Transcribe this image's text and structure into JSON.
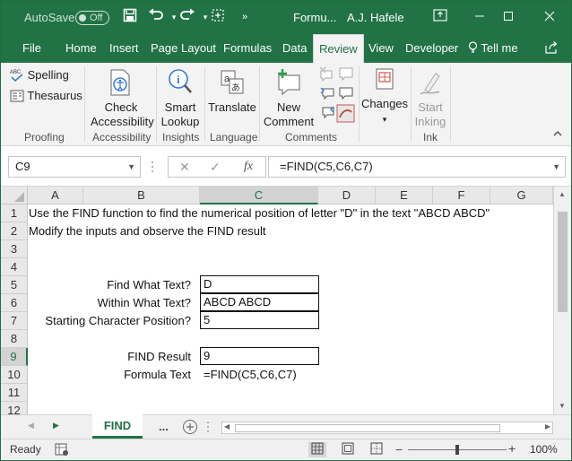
{
  "titlebar": {
    "autosave_label": "AutoSave",
    "autosave_state": "Off",
    "doc_title": "Formu...",
    "user_name": "A.J. Hafele"
  },
  "tabs": [
    {
      "label": "File"
    },
    {
      "label": "Home"
    },
    {
      "label": "Insert"
    },
    {
      "label": "Page Layout"
    },
    {
      "label": "Formulas"
    },
    {
      "label": "Data"
    },
    {
      "label": "Review",
      "active": true
    },
    {
      "label": "View"
    },
    {
      "label": "Developer"
    }
  ],
  "tell_me": "Tell me",
  "ribbon": {
    "spelling": "Spelling",
    "thesaurus": "Thesaurus",
    "proofing": "Proofing",
    "check_accessibility_1": "Check",
    "check_accessibility_2": "Accessibility",
    "accessibility": "Accessibility",
    "smart_lookup_1": "Smart",
    "smart_lookup_2": "Lookup",
    "insights": "Insights",
    "translate": "Translate",
    "language": "Language",
    "new_comment_1": "New",
    "new_comment_2": "Comment",
    "comments": "Comments",
    "changes": "Changes",
    "start_inking_1": "Start",
    "start_inking_2": "Inking",
    "ink": "Ink"
  },
  "formula_bar": {
    "name_box": "C9",
    "formula": "=FIND(C5,C6,C7)"
  },
  "columns": [
    "A",
    "B",
    "C",
    "D",
    "E",
    "F",
    "G"
  ],
  "rows": [
    "1",
    "2",
    "3",
    "4",
    "5",
    "6",
    "7",
    "8",
    "9",
    "10",
    "11",
    "12"
  ],
  "cells": {
    "a1": "Use the FIND function to find the numerical position of letter \"D\" in the text \"ABCD ABCD\"",
    "a2": "Modify the inputs and observe the FIND result",
    "b5": "Find What Text?",
    "b6": "Within What Text?",
    "b7": "Starting Character Position?",
    "b9": "FIND Result",
    "b10": "Formula Text",
    "c5": "D",
    "c6": "ABCD ABCD",
    "c7": "5",
    "c9": "9",
    "c10": "=FIND(C5,C6,C7)"
  },
  "sheet": {
    "active_tab": "FIND",
    "more": "..."
  },
  "status": {
    "ready": "Ready",
    "zoom": "100%"
  },
  "colors": {
    "brand": "#217346"
  }
}
